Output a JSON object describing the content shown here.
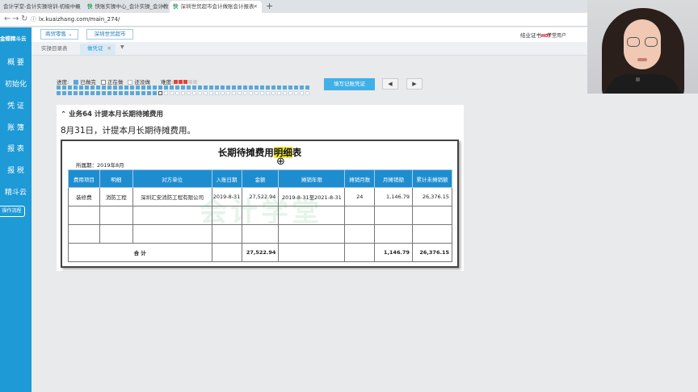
{
  "browser": {
    "tabs": [
      {
        "title": "会计学堂-会计实操培训-初级中级",
        "active": false
      },
      {
        "title": "快账实操中心_会计实操_会计教",
        "active": false
      },
      {
        "title": "深圳世贸超市会计做账会计报表",
        "active": true
      }
    ],
    "new_tab": "+",
    "url": "lx.kuaizhang.com/main_274/"
  },
  "sidebar": {
    "logo": "金蝶精斗云",
    "items": [
      "概 要",
      "初始化",
      "凭 证",
      "账 簿",
      "报 表",
      "报 税",
      "精斗云"
    ],
    "op_flow": "操作流程"
  },
  "topbar": {
    "company_select": "商贸零售",
    "org_select": "深圳世贸超市",
    "cert_label": "结业证书",
    "cert_badge": "HOT",
    "user": "学堂用户"
  },
  "page_tabs": [
    {
      "label": "实操目录表",
      "active": false
    },
    {
      "label": "做凭证",
      "active": true
    }
  ],
  "progress": {
    "label": "进度:",
    "legend_done": "已做完",
    "legend_doing": "正在做",
    "legend_todo": "还没做",
    "difficulty_label": "难度:",
    "difficulty_stars": 3,
    "difficulty_max": 5,
    "total_tasks": 90,
    "done_tasks": 63,
    "current_task": 64
  },
  "buttons": {
    "fill_voucher": "填写记账凭证",
    "prev": "◀",
    "next": "▶"
  },
  "task": {
    "title": "业务64 计提本月长期待摊费用",
    "desc": "8月31日，计提本月长期待摊费用。"
  },
  "sheet": {
    "title_pre": "长期待摊费用",
    "title_hl": "明细",
    "title_post": "表",
    "period": "所属期：2019年8月",
    "watermark": "会计学堂",
    "headers": [
      "费用项目",
      "明细",
      "对方单位",
      "入账日期",
      "金额",
      "摊销年限",
      "摊销月数",
      "月摊销额",
      "累计未摊销额"
    ],
    "rows": [
      [
        "装修费",
        "消防工程",
        "深圳汇安消防工程有限公司",
        "2019-8-31",
        "27,522.94",
        "2019-8-31至2021-8-31",
        "24",
        "1,146.79",
        "26,376.15"
      ],
      [
        "",
        "",
        "",
        "",
        "",
        "",
        "",
        "",
        ""
      ],
      [
        "",
        "",
        "",
        "",
        "",
        "",
        "",
        "",
        ""
      ]
    ],
    "total": [
      "合  计",
      "",
      "",
      "",
      "27,522.94",
      "",
      "",
      "1,146.79",
      "26,376.15"
    ]
  },
  "colors": {
    "sidebar": "#1e9ad6",
    "header_blue": "#1e8dd0",
    "done": "#5aa8d8",
    "todo": "#ffffff",
    "highlight": "#f5ec3a"
  }
}
